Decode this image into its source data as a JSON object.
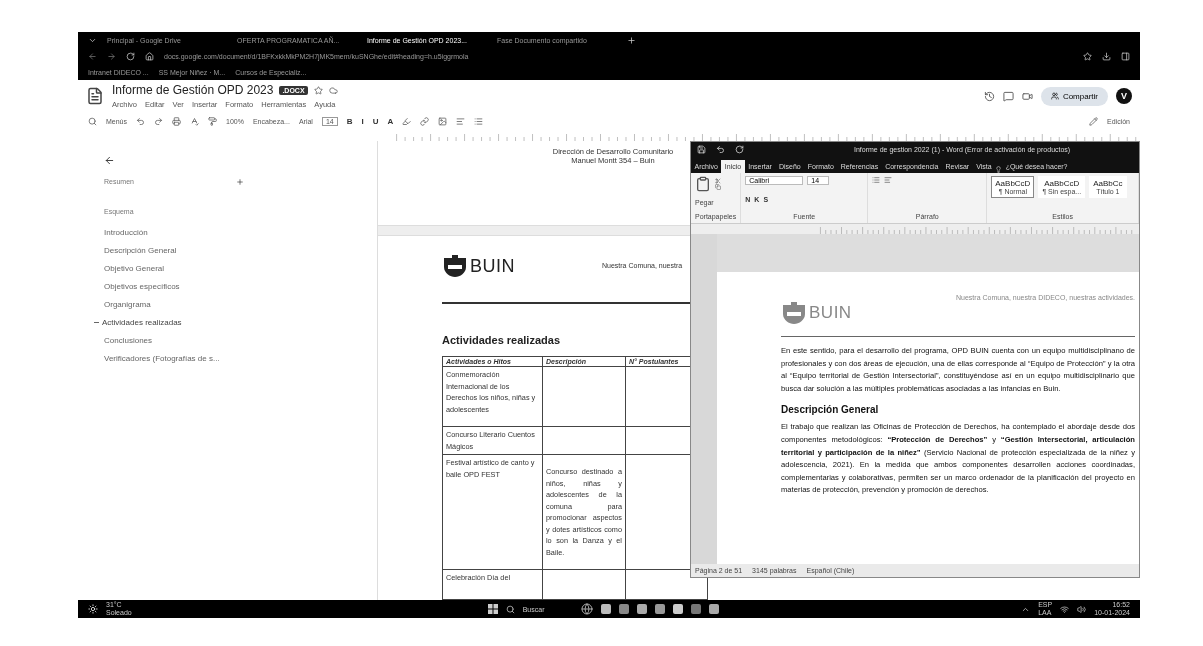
{
  "browser": {
    "tabs": [
      {
        "label": "Principal - Google Drive",
        "selected": false
      },
      {
        "label": "OFERTA PROGRAMATICA AÑ...",
        "selected": false
      },
      {
        "label": "Informe de Gestión OPD 2023...",
        "selected": true
      },
      {
        "label": "Fase Documento compartido",
        "selected": false
      }
    ],
    "address": "docs.google.com/document/d/1BFKxkkMkPM2H7jMK5mem/kuSNGhe/edit#heading=h.u5iggrmola",
    "bookmarks": [
      "Intranet DIDECO ...",
      "SS Mejor Niñez · M...",
      "Cursos de Especializ..."
    ]
  },
  "docs": {
    "title": "Informe de Gestión OPD 2023",
    "badge": ".DOCX",
    "menu": [
      "Archivo",
      "Editar",
      "Ver",
      "Insertar",
      "Formato",
      "Herramientas",
      "Ayuda"
    ],
    "share": "Compartir",
    "avatar": "V",
    "toolbar": {
      "menus": "Menús",
      "zoom": "100%",
      "style": "Encabeza...",
      "font": "Arial",
      "size": "14",
      "format": [
        "B",
        "I",
        "U",
        "A"
      ],
      "mode": "Edición"
    },
    "outline": {
      "summary": "Resumen",
      "heading": "Esquema",
      "items": [
        {
          "label": "Introducción",
          "selected": false
        },
        {
          "label": "Descripción General",
          "selected": false
        },
        {
          "label": "Objetivo General",
          "selected": false
        },
        {
          "label": "Objetivos específicos",
          "selected": false
        },
        {
          "label": "Organigrama",
          "selected": false
        },
        {
          "label": "Actividades realizadas",
          "selected": true
        },
        {
          "label": "Conclusiones",
          "selected": false
        },
        {
          "label": "Verificadores (Fotografías de s...",
          "selected": false
        }
      ]
    },
    "page": {
      "header": [
        "Dirección de Desarrollo Comunitario",
        "Manuel Montt 354 – Buin"
      ],
      "logo": "BUIN",
      "tagline": "Nuestra Comuna, nuestra",
      "heading": "Actividades realizadas",
      "table": {
        "columns": [
          "Actividades o Hitos",
          "Descripción",
          "N° Postulantes"
        ],
        "rows": [
          {
            "cells": [
              "Conmemoración Internacional de los Derechos los niños, niñas y adolescentes"
            ]
          },
          {
            "cells": [
              "Concurso Literario Cuentos Mágicos"
            ]
          },
          {
            "cells": [
              "Festival artístico de canto y baile OPD FEST",
              "Concurso destinado a niños, niñas y adolescentes de la comuna para promocionar aspectos y dotes artísticos como lo son la Danza y el Baile."
            ]
          },
          {
            "cells": [
              "Celebración Día del"
            ]
          }
        ]
      }
    }
  },
  "word": {
    "title": "Informe de gestion 2022 (1) - Word (Error de activación de productos)",
    "tabs": [
      {
        "label": "Archivo",
        "selected": false
      },
      {
        "label": "Inicio",
        "selected": true
      },
      {
        "label": "Insertar",
        "selected": false
      },
      {
        "label": "Diseño",
        "selected": false
      },
      {
        "label": "Formato",
        "selected": false
      },
      {
        "label": "Referencias",
        "selected": false
      },
      {
        "label": "Correspondencia",
        "selected": false
      },
      {
        "label": "Revisar",
        "selected": false
      },
      {
        "label": "Vista",
        "selected": false
      }
    ],
    "search": "¿Qué desea hacer?",
    "paste": "Pegar",
    "font": "Calibri",
    "size": "14",
    "format": [
      "N",
      "K",
      "S"
    ],
    "groups": [
      "Portapapeles",
      "Fuente",
      "Párrafo",
      "Estilos"
    ],
    "styles": [
      {
        "sample": "AaBbCcD",
        "name": "¶ Normal",
        "selected": true
      },
      {
        "sample": "AaBbCcD",
        "name": "¶ Sin espa...",
        "selected": false
      },
      {
        "sample": "AaBbCc",
        "name": "Título 1",
        "selected": false
      }
    ],
    "page": {
      "logo": "BUIN",
      "tagline": "Nuestra Comuna, nuestra DIDECO, nuestras actividades.",
      "paragraph": "En este sentido, para el desarrollo del programa, OPD BUIN cuenta con un equipo multidisciplinano de profesionales y con dos áreas de ejecución, una de ellas corresponde al “Equipo de Protección” y la otra al “Equipo territorial de Gestión Intersectorial”, constituyéndose así en un equipo multidisciplinario que busca dar solución a las múltiples problemáticas asociadas a las infancias en Buin.",
      "heading": "Descripción General",
      "body": "El trabajo que realizan las Oficinas de Protección de Derechos, ha contemplado el abordaje desde dos componentes metodológicos: **“Protección de Derechos”** y **“Gestión Intersectorial, articulación territorial y participación de la niñez”** (Servicio Nacional de protección especializada de la niñez y adolescencia, 2021). En la medida que ambos componentes desarrollen acciones coordinadas, complementarias y colaborativas, permiten ser un marco ordenador de la planificación del proyecto en materias de protección, prevención y promoción de derechos."
    },
    "status": [
      "Página 2 de 51",
      "3145 palabras",
      "Español (Chile)"
    ]
  },
  "taskbar": {
    "temperature": "31°C",
    "weather": "Soleado",
    "search": "Buscar",
    "language": [
      "ESP",
      "LAA"
    ],
    "time": "16:52",
    "date": "10-01-2024"
  }
}
